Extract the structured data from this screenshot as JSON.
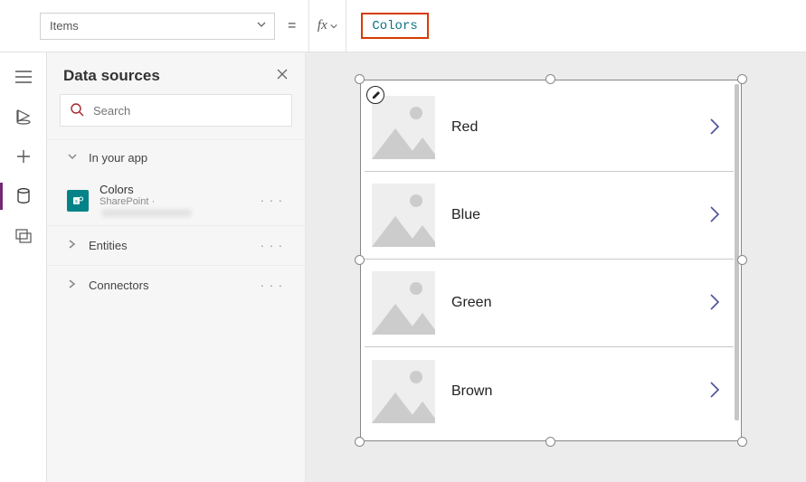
{
  "formula_bar": {
    "property": "Items",
    "fx_label": "fx",
    "expression": "Colors"
  },
  "data_panel": {
    "title": "Data sources",
    "search_placeholder": "Search",
    "section_in_app": "In your app",
    "data_source": {
      "name": "Colors",
      "provider": "SharePoint · "
    },
    "entities_label": "Entities",
    "connectors_label": "Connectors"
  },
  "gallery": {
    "items": [
      {
        "label": "Red"
      },
      {
        "label": "Blue"
      },
      {
        "label": "Green"
      },
      {
        "label": "Brown"
      }
    ]
  }
}
